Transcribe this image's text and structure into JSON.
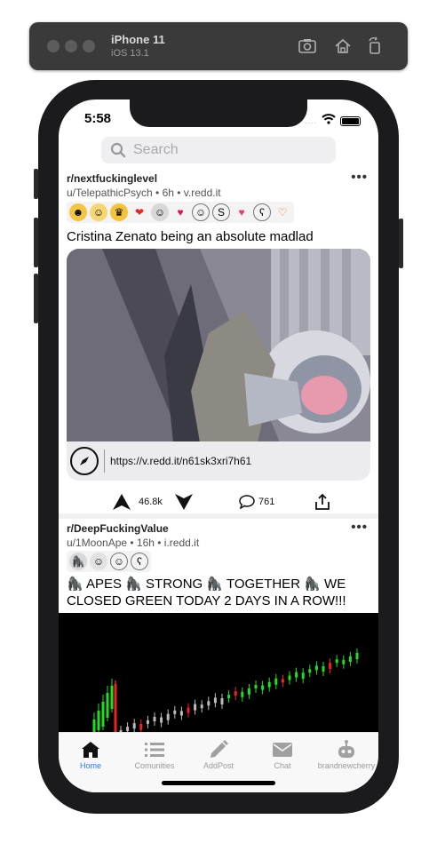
{
  "simulator": {
    "device": "iPhone 11",
    "os": "iOS 13.1"
  },
  "status_bar": {
    "time": "5:58"
  },
  "search": {
    "placeholder": "Search"
  },
  "posts": [
    {
      "subreddit": "r/nextfuckinglevel",
      "meta": "u/TelepathicPsych • 6h • v.redd.it",
      "award_icons": [
        "gold-award",
        "hugz-award",
        "crown-award",
        "heartwarming-award",
        "wholesome-award",
        "heart-award",
        "smile-award",
        "silver-award",
        "love-award",
        "bear-award",
        "hug-award"
      ],
      "title": "Cristina Zenato being an absolute madlad",
      "link": "https://v.redd.it/n61sk3xri7h61",
      "score": "46.8k",
      "comments": "761"
    },
    {
      "subreddit": "r/DeepFuckingValue",
      "meta": "u/1MoonApe • 16h • i.redd.it",
      "award_icons": [
        "ape-award",
        "wholesome-award",
        "smile-award",
        "bear-award"
      ],
      "title": "🦍 APES 🦍 STRONG 🦍 TOGETHER 🦍 WE CLOSED GREEN TODAY 2 DAYS IN A ROW!!!"
    }
  ],
  "tabs": [
    {
      "label": "Home",
      "icon": "home-icon",
      "active": true
    },
    {
      "label": "Comunities",
      "icon": "list-icon",
      "active": false
    },
    {
      "label": "AddPost",
      "icon": "pencil-icon",
      "active": false
    },
    {
      "label": "Chat",
      "icon": "mail-icon",
      "active": false
    },
    {
      "label": "brandnewcherry",
      "icon": "robot-icon",
      "active": false
    }
  ],
  "colors": {
    "accent": "#2d7be5",
    "candle_up": "#22dd22",
    "candle_down": "#ee2222"
  }
}
